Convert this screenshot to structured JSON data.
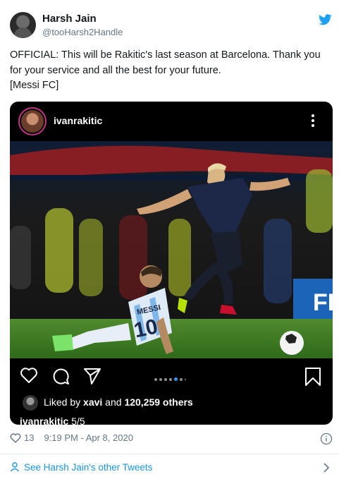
{
  "tweet": {
    "author_name": "Harsh Jain",
    "author_handle": "@tooHarsh2Handle",
    "text": "OFFICIAL: This will be Rakitic's last season at Barcelona. Thank you for your service and all the best for your future.\n [Messi FC]",
    "like_count": "13",
    "timestamp": "9:19 PM - Apr 8, 2020",
    "see_more_label": "See Harsh Jain's other Tweets"
  },
  "instagram": {
    "username": "ivanrakitic",
    "liked_by_prefix": "Liked by ",
    "liked_by_user": "xavi",
    "liked_by_and": " and ",
    "liked_by_count": "120,259 others",
    "caption_user": "ivanrakitic",
    "caption_text": " 5/5",
    "carousel_total": 7,
    "carousel_active_index": 4,
    "photo_jersey_number": "10",
    "photo_jersey_name": "MESSI",
    "photo_banner_text": "FI"
  },
  "colors": {
    "twitter_blue": "#1da1f2",
    "link_blue": "#1b95e0",
    "secondary_text": "#657786",
    "instagram_active_dot": "#3897f0"
  },
  "icons": {
    "brand": "twitter-bird-icon",
    "like": "heart-icon",
    "comment": "comment-icon",
    "share": "paper-plane-icon",
    "save": "bookmark-icon",
    "more": "more-vertical-icon",
    "info": "info-icon",
    "person": "person-icon",
    "chevron": "chevron-right-icon"
  }
}
